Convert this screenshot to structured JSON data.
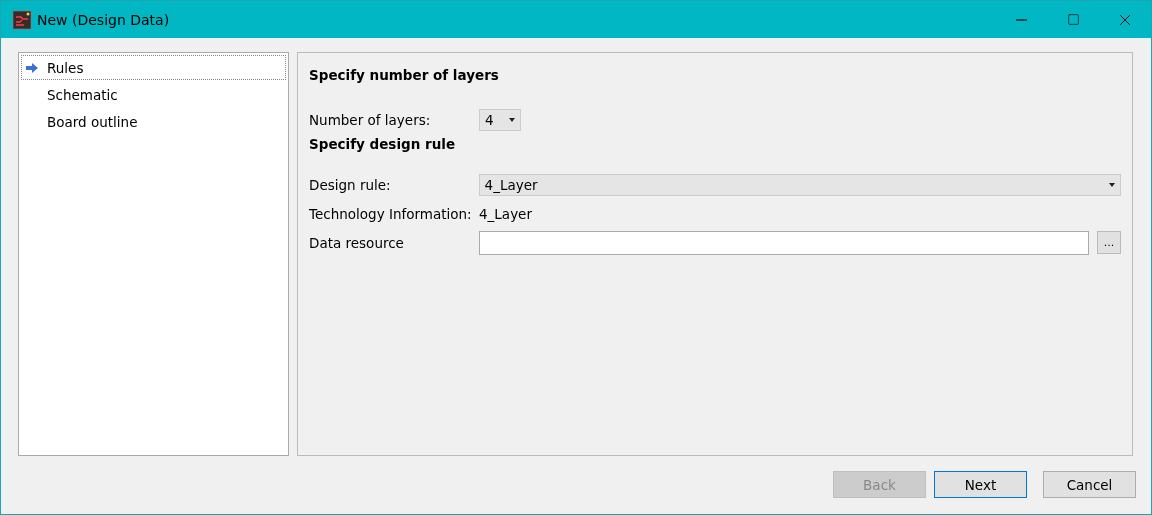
{
  "window": {
    "title": "New (Design Data)"
  },
  "nav": {
    "items": [
      {
        "label": "Rules",
        "selected": true
      },
      {
        "label": "Schematic",
        "selected": false
      },
      {
        "label": "Board outline",
        "selected": false
      }
    ]
  },
  "sections": [
    {
      "heading": "Specify number of layers",
      "rows": [
        {
          "kind": "small-select",
          "label": "Number of layers:",
          "value": "4"
        }
      ]
    },
    {
      "heading": "Specify design rule",
      "rows": [
        {
          "kind": "select",
          "label": "Design rule:",
          "value": "4_Layer"
        },
        {
          "kind": "text",
          "label": "Technology Information:",
          "value": "4_Layer"
        },
        {
          "kind": "browse",
          "label": "Data resource",
          "button": "..."
        }
      ]
    }
  ],
  "buttons": [
    {
      "label": "Back",
      "disabled": true,
      "default": false
    },
    {
      "label": "Next",
      "disabled": false,
      "default": true
    },
    {
      "label": "Cancel",
      "disabled": false,
      "default": false
    }
  ]
}
